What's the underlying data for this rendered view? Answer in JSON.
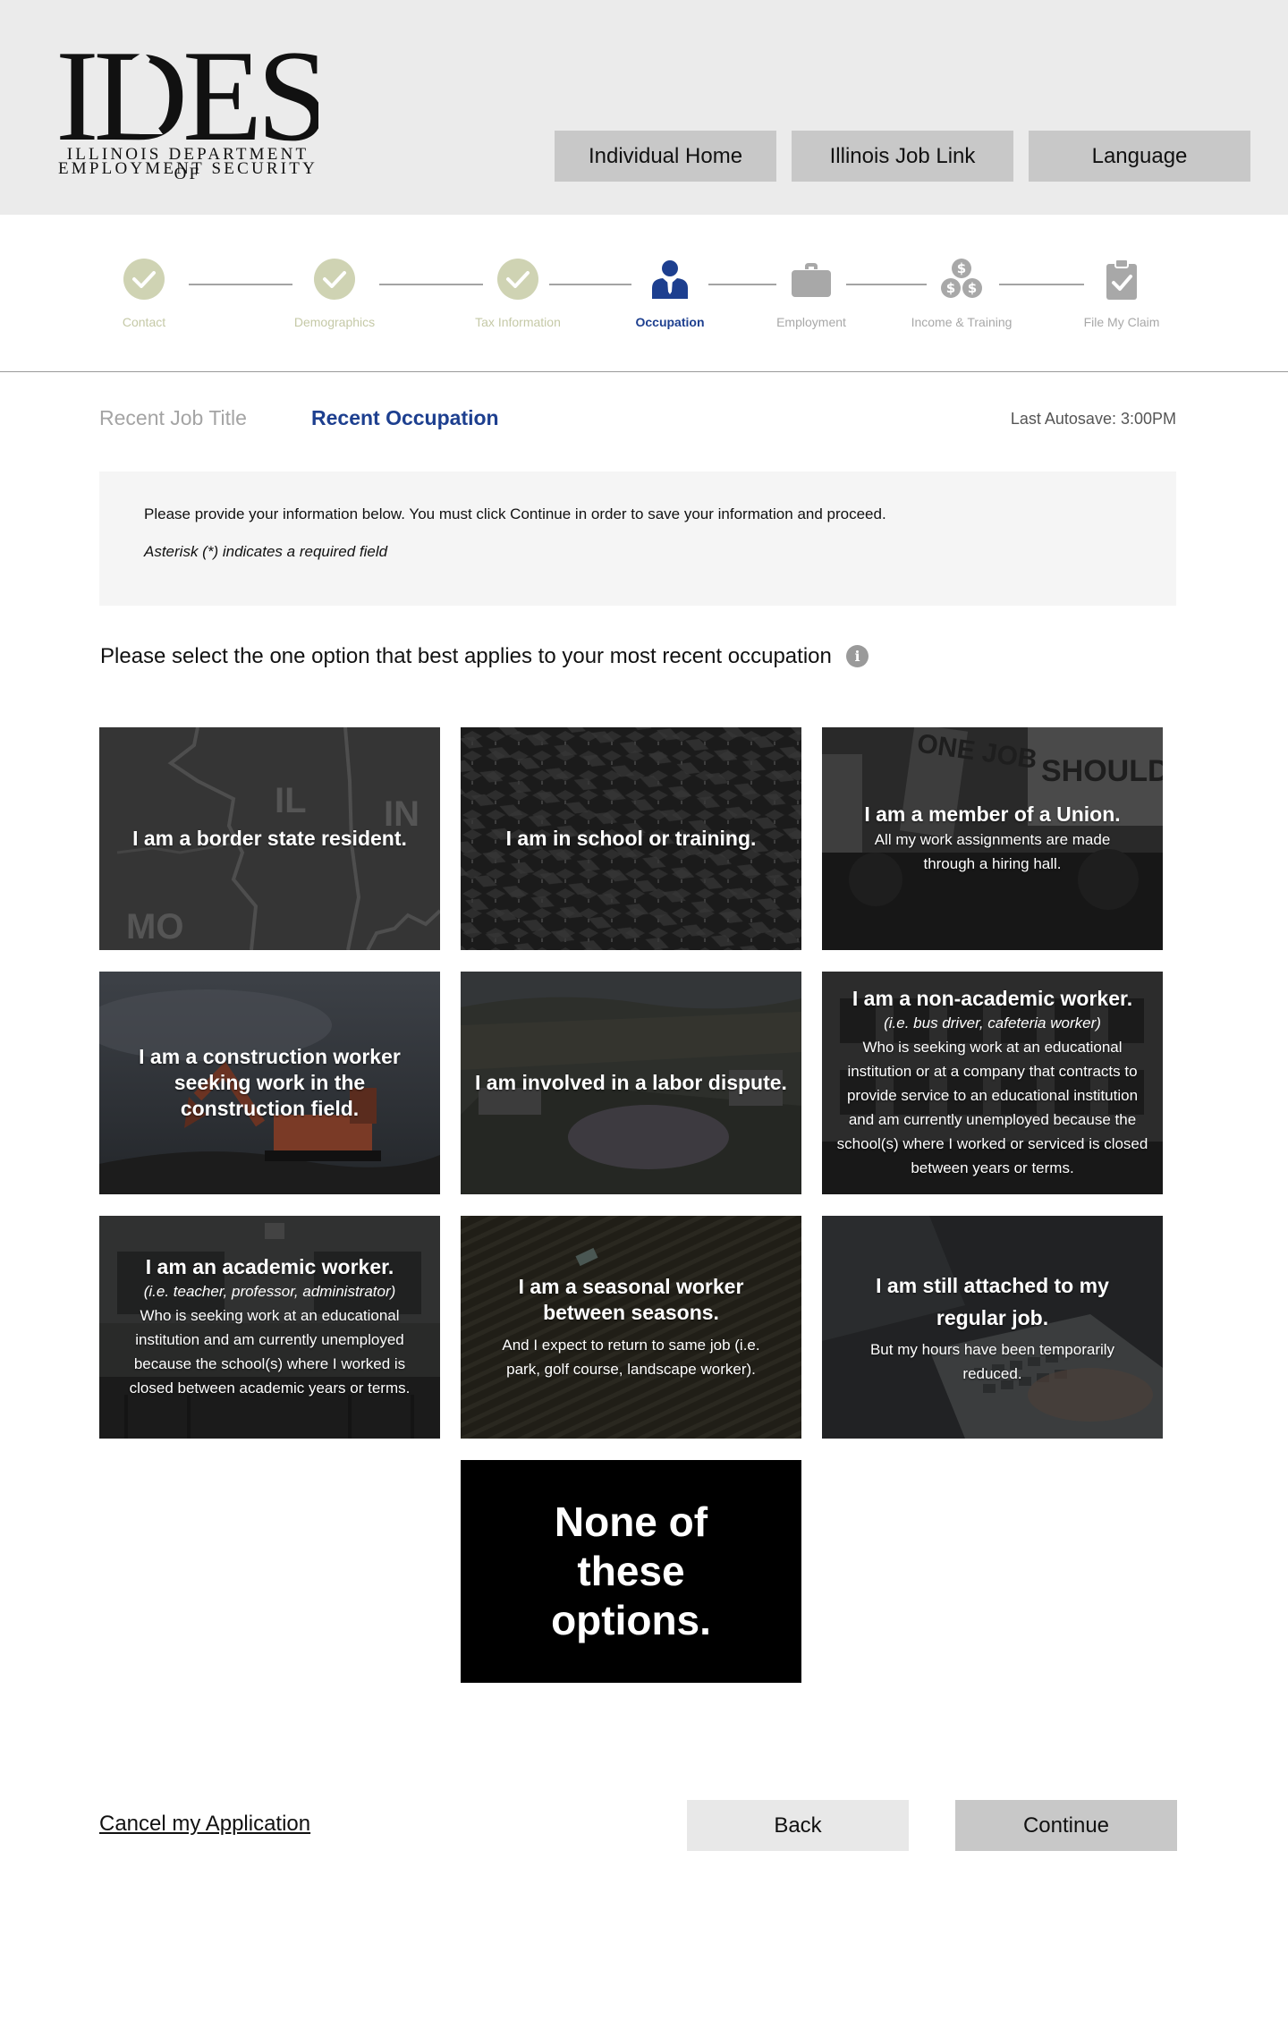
{
  "header": {
    "logo": {
      "wordmark": "IDES",
      "line1": "ILLINOIS DEPARTMENT OF",
      "line2": "EMPLOYMENT SECURITY"
    },
    "nav": [
      {
        "label": "Individual Home"
      },
      {
        "label": "Illinois Job Link"
      },
      {
        "label": "Language"
      }
    ]
  },
  "stepper": {
    "steps": [
      {
        "label": "Contact",
        "state": "done",
        "icon": "check-icon"
      },
      {
        "label": "Demographics",
        "state": "done",
        "icon": "check-icon"
      },
      {
        "label": "Tax Information",
        "state": "done",
        "icon": "check-icon"
      },
      {
        "label": "Occupation",
        "state": "active",
        "icon": "person-icon"
      },
      {
        "label": "Employment",
        "state": "todo",
        "icon": "briefcase-icon"
      },
      {
        "label": "Income & Training",
        "state": "todo",
        "icon": "coins-icon"
      },
      {
        "label": "File My Claim",
        "state": "todo",
        "icon": "clipboard-check-icon"
      }
    ],
    "colors": {
      "done": "#cfd3b3",
      "active": "#1d3f8f",
      "todo": "#a8a8a8"
    }
  },
  "tabs": [
    {
      "label": "Recent Job Title",
      "active": false
    },
    {
      "label": "Recent Occupation",
      "active": true
    }
  ],
  "autosave": "Last Autosave: 3:00PM",
  "info": {
    "text": "Please provide your information below. You must click Continue in order to save your information and proceed.",
    "note": "Asterisk (*) indicates a required field"
  },
  "question": "Please select the one option that best applies to your most recent occupation",
  "options": [
    {
      "title": "I am a border state resident.",
      "map_labels": [
        "IL",
        "IN",
        "MO"
      ]
    },
    {
      "title": "I am in school or training."
    },
    {
      "title": "I am a member of a Union.",
      "body": "All my work  assignments are made through a hiring hall.",
      "sign_text": [
        "ONE JOB",
        "SHOULD BE ENOUGH"
      ]
    },
    {
      "title": "I am a construction worker seeking work in the construction field."
    },
    {
      "title": "I am involved in a labor dispute."
    },
    {
      "title": "I am a non-academic worker.",
      "sub": "(i.e. bus driver, cafeteria worker)",
      "body": "Who is seeking work at an educational institution or at a company that contracts to provide service to an educational institution and am currently unemployed because the school(s) where I worked or serviced is closed between years or terms."
    },
    {
      "title": "I am an academic worker.",
      "sub": "(i.e. teacher, professor, administrator)",
      "body": "Who is seeking work at an educational institution and am currently unemployed because the school(s) where I worked is closed between academic years or terms."
    },
    {
      "title": "I am a seasonal worker between seasons.",
      "body": "And I expect to return to same job (i.e. park, golf course, landscape worker)."
    },
    {
      "title": "I am still attached to my regular job.",
      "body": "But my hours have been temporarily reduced."
    },
    {
      "title": "None of these options."
    }
  ],
  "actions": {
    "cancel": "Cancel my Application",
    "back": "Back",
    "continue": "Continue"
  }
}
